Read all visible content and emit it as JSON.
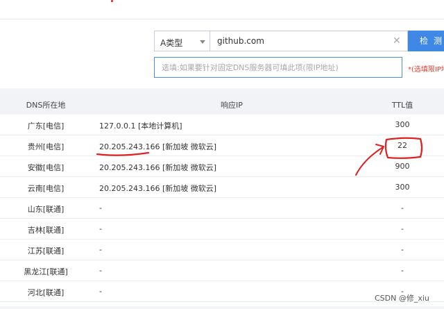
{
  "query": {
    "record_type": "A类型",
    "domain_value": "github.com",
    "check_label": "检测",
    "dns_placeholder": "选填:如果要针对固定DNS服务器可填此项(限IP地址)",
    "optional_note": "*(选填限IP地"
  },
  "table": {
    "headers": {
      "location": "DNS所在地",
      "ip": "响应IP",
      "ttl": "TTL值"
    },
    "rows": [
      {
        "location": "广东[电信]",
        "ip": "127.0.0.1 [本地计算机]",
        "ttl": "300"
      },
      {
        "location": "贵州[电信]",
        "ip": "20.205.243.166 [新加坡 微软云]",
        "ttl": "22"
      },
      {
        "location": "安徽[电信]",
        "ip": "20.205.243.166 [新加坡 微软云]",
        "ttl": "900"
      },
      {
        "location": "云南[电信]",
        "ip": "20.205.243.166 [新加坡 微软云]",
        "ttl": "300"
      },
      {
        "location": "山东[联通]",
        "ip": "-",
        "ttl": "-"
      },
      {
        "location": "吉林[联通]",
        "ip": "-",
        "ttl": "-"
      },
      {
        "location": "江苏[联通]",
        "ip": "-",
        "ttl": "-"
      },
      {
        "location": "黑龙江[联通]",
        "ip": "-",
        "ttl": "-"
      },
      {
        "location": "河北[联通]",
        "ip": "-",
        "ttl": "-"
      }
    ]
  },
  "watermark": "CSDN @修_xiu",
  "colors": {
    "accent": "#3f88e6",
    "annotation": "#e02020",
    "note": "#e03c2c"
  }
}
